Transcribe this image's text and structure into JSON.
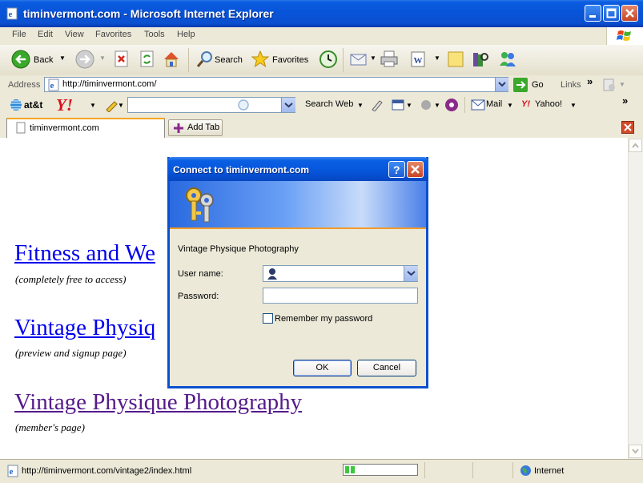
{
  "window": {
    "title": "timinvermont.com - Microsoft Internet Explorer"
  },
  "menu": [
    "File",
    "Edit",
    "View",
    "Favorites",
    "Tools",
    "Help"
  ],
  "toolbar": {
    "back_label": "Back",
    "search_label": "Search",
    "favorites_label": "Favorites"
  },
  "address": {
    "label": "Address",
    "url": "http://timinvermont.com/",
    "go_label": "Go",
    "links_label": "Links"
  },
  "searchbar": {
    "brand": "at&t",
    "search_web_label": "Search Web",
    "mail_label": "Mail",
    "yahoo_label": "Yahoo!"
  },
  "tabs": {
    "active_title": "timinvermont.com",
    "add_tab_label": "Add Tab"
  },
  "page": {
    "links": [
      {
        "text": "Fitness and We",
        "note": "(completely free to access)"
      },
      {
        "text": "Vintage Physiq",
        "note": "(preview and signup page)"
      },
      {
        "text": "Vintage Physique Photography",
        "note": "(member's page)"
      }
    ],
    "link_color": "#0000ee",
    "visited_color": "#551a8b"
  },
  "status": {
    "text": "http://timinvermont.com/vintage2/index.html",
    "zone": "Internet"
  },
  "dialog": {
    "title": "Connect to timinvermont.com",
    "realm": "Vintage Physique Photography",
    "username_label": "User name:",
    "username_value": "",
    "password_label": "Password:",
    "password_value": "",
    "remember_label": "Remember my password",
    "ok_label": "OK",
    "cancel_label": "Cancel"
  }
}
